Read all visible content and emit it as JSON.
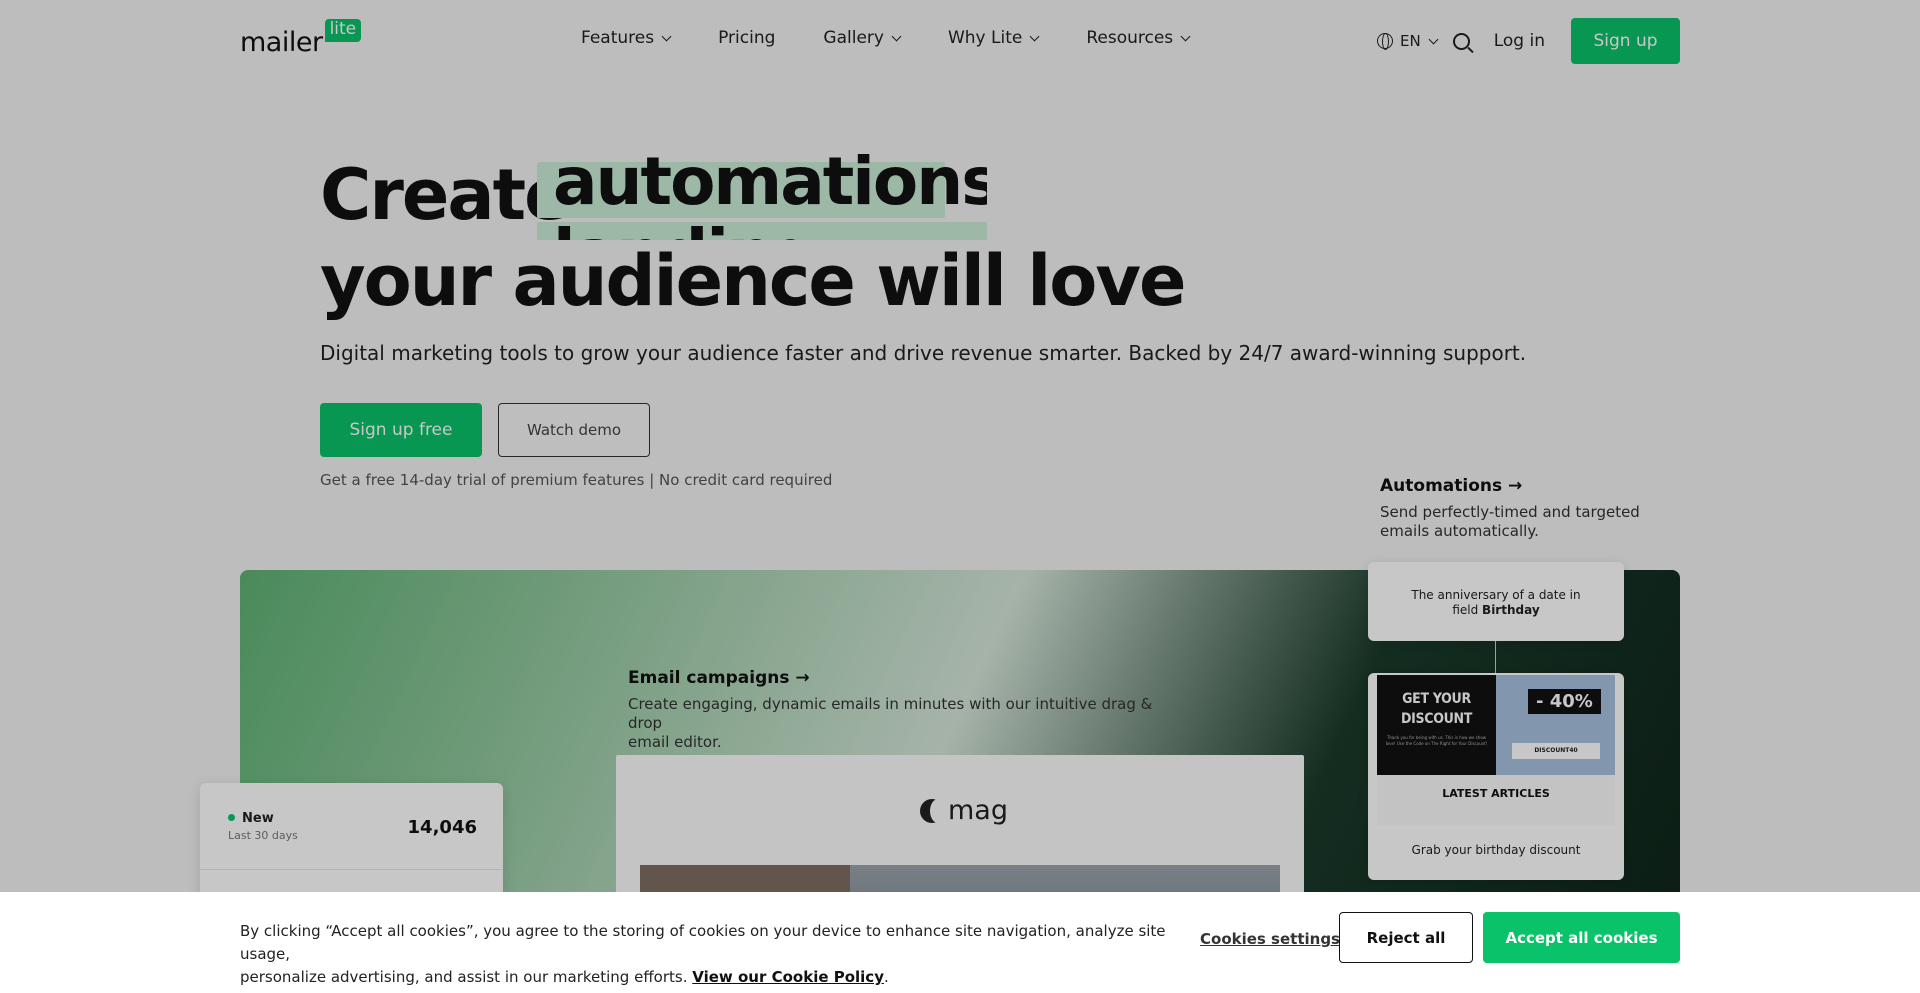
{
  "header": {
    "logo_text": "mailer",
    "logo_badge": "lite",
    "nav": [
      {
        "label": "Features",
        "dropdown": true
      },
      {
        "label": "Pricing",
        "dropdown": false
      },
      {
        "label": "Gallery",
        "dropdown": true
      },
      {
        "label": "Why Lite",
        "dropdown": true
      },
      {
        "label": "Resources",
        "dropdown": true
      }
    ],
    "language": "EN",
    "login_label": "Log in",
    "signup_label": "Sign up"
  },
  "hero": {
    "line1": "Create",
    "rotating_word": "automations",
    "rotating_word_next": "landing pages",
    "line2": "your audience will love",
    "subtitle": "Digital marketing tools to grow your audience faster and drive revenue smarter. Backed by 24/7 award-winning support.",
    "cta_primary": "Sign up free",
    "cta_secondary": "Watch demo",
    "trial_note": "Get a free 14-day trial of premium features | No credit card required"
  },
  "showcase": {
    "email_campaigns": {
      "title": "Email campaigns →",
      "desc_line1": "Create engaging, dynamic emails in minutes with our intuitive drag & drop",
      "desc_line2": "email editor."
    },
    "automations": {
      "title": "Automations →",
      "desc_line1": "Send perfectly-timed and targeted",
      "desc_line2": "emails automatically."
    },
    "email_preview": {
      "brand": "mag"
    },
    "stat": {
      "label": "New",
      "period": "Last 30 days",
      "value": "14,046"
    },
    "trigger": {
      "line1": "The anniversary of a date in",
      "line2_prefix": "field ",
      "line2_field": "Birthday"
    },
    "discount_email": {
      "headline_1": "GET YOUR",
      "headline_2": "DISCOUNT",
      "fine_print": "Thank you for being with us. This is how we show love! Use the Code on The Right for Your Discount!",
      "percent": "- 40%",
      "code": "DISCOUNT40",
      "section": "LATEST ARTICLES",
      "subject": "Grab your birthday discount"
    }
  },
  "cookie_banner": {
    "text_line1": "By clicking “Accept all cookies”, you agree to the storing of cookies on your device to enhance site navigation, analyze site usage,",
    "text_line2": "personalize advertising, and assist in our marketing efforts.",
    "policy_link": "View our Cookie Policy",
    "settings_label": "Cookies settings",
    "reject_label": "Reject all",
    "accept_label": "Accept all cookies"
  },
  "colors": {
    "brand_green": "#09c269",
    "highlight": "#c9ecd6"
  }
}
